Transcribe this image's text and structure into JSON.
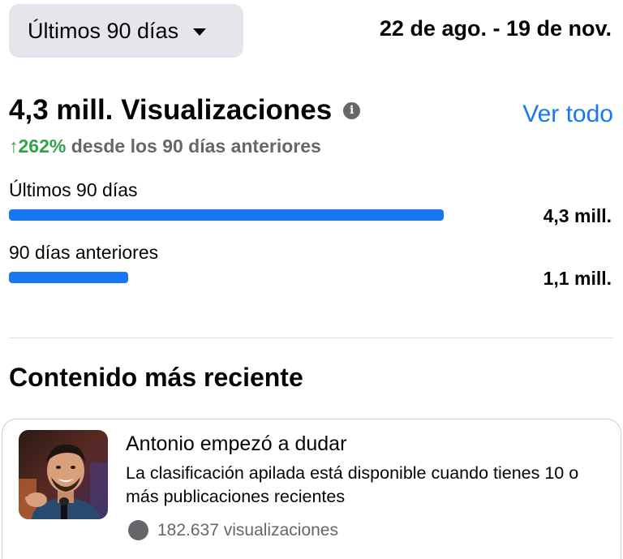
{
  "range_selector": {
    "label": "Últimos 90 días",
    "icon": "chevron-down-icon"
  },
  "date_range": "22 de ago. - 19 de nov.",
  "summary": {
    "headline": "4,3 mill. Visualizaciones",
    "info_icon": "info-icon",
    "see_all_label": "Ver todo",
    "change_arrow": "↑",
    "change_pct": "262%",
    "change_text": " desde los 90 días anteriores",
    "change_color": "#31a24c"
  },
  "periods": [
    {
      "label": "Últimos 90 días",
      "value": "4,3 mill.",
      "fill_fraction": 1.0
    },
    {
      "label": "90 días anteriores",
      "value": "1,1 mill.",
      "fill_fraction": 0.275
    }
  ],
  "accent_color": "#1877f2",
  "recent": {
    "title": "Contenido más reciente",
    "card": {
      "title": "Antonio empezó a dudar",
      "description": "La clasificación apilada está disponible cuando tienes 10 o más publicaciones recientes",
      "views": "182.637 visualizaciones"
    }
  }
}
